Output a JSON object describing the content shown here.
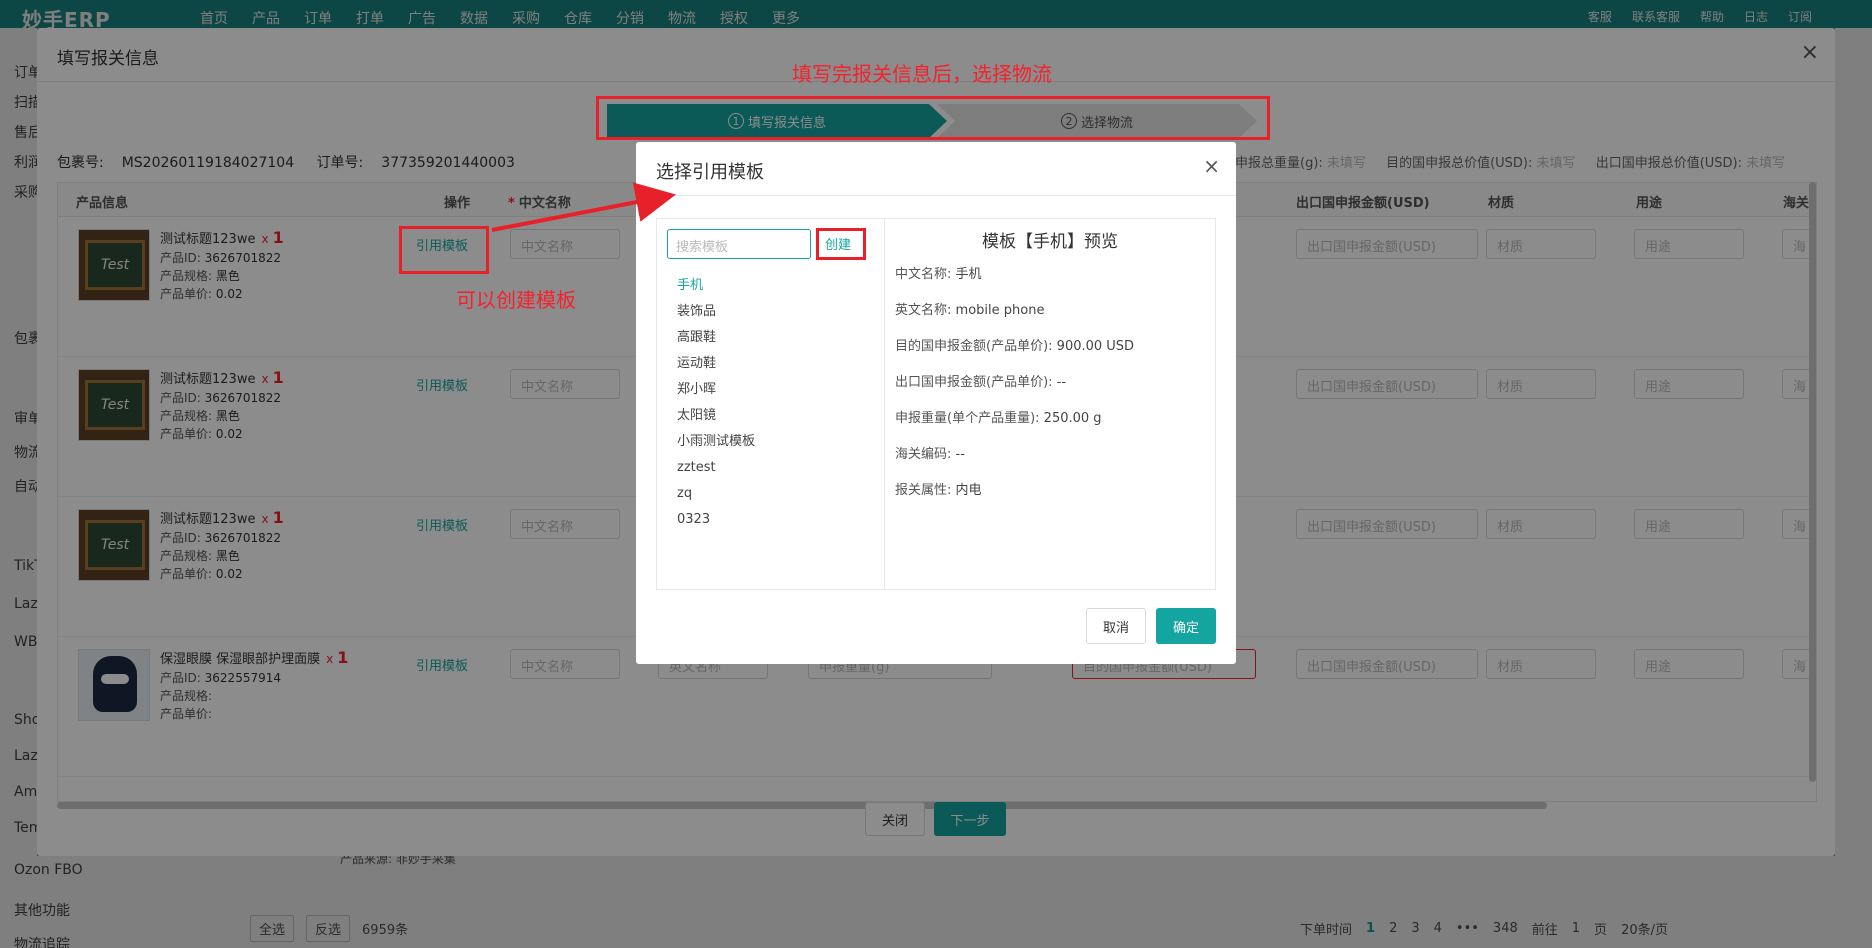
{
  "app": {
    "logo": "妙手ERP",
    "nav": [
      "首页",
      "产品",
      "订单",
      "打单",
      "广告",
      "数据",
      "采购",
      "仓库",
      "分销",
      "物流",
      "授权",
      "更多"
    ],
    "top_right": [
      "客服",
      "联系客服",
      "帮助",
      "日志",
      "订阅"
    ],
    "sidebar_items": [
      "订单",
      "扫描",
      "售后",
      "利润",
      "采购",
      "包裹",
      "审单",
      "物流",
      "自动",
      "TikTok",
      "Lazada",
      "WB",
      "Shopee",
      "Lazada",
      "Amazon",
      "Temu",
      "Ozon FBO",
      "其他功能",
      "物流追踪"
    ],
    "footer": {
      "select_all": "全选",
      "invert": "反选",
      "count": "6959条"
    },
    "pager": {
      "sort": "下单时间",
      "pages": [
        "1",
        "2",
        "3",
        "4",
        "•••",
        "348"
      ],
      "goto": "前往",
      "page_input": "1",
      "page_unit": "页",
      "page_size": "20条/页"
    },
    "strip_text": "产品来源: 非妙手采集"
  },
  "outer_modal": {
    "title": "填写报关信息",
    "annotation_top": "填写完报关信息后，选择物流",
    "annotation_left": "可以创建模板",
    "steps": [
      {
        "num": "1",
        "label": "填写报关信息"
      },
      {
        "num": "2",
        "label": "选择物流"
      }
    ],
    "package_no_label": "包裹号:",
    "package_no": "MS20260119184027104",
    "order_no_label": "订单号:",
    "order_no": "377359201440003",
    "right_info": [
      {
        "label": "申报总重量(g):",
        "value": "未填写"
      },
      {
        "label": "目的国申报总价值(USD):",
        "value": "未填写"
      },
      {
        "label": "出口国申报总价值(USD):",
        "value": "未填写"
      }
    ],
    "columns": {
      "product": "产品信息",
      "action": "操作",
      "cn_name": "中文名称",
      "export_amount": "出口国申报金额(USD)",
      "material": "材质",
      "usage": "用途",
      "customs": "海关"
    },
    "rows": [
      {
        "title": "测试标题123we",
        "qty_prefix": "x",
        "qty": "1",
        "id_label": "产品ID:",
        "id": "3626701822",
        "spec_label": "产品规格:",
        "spec": "黑色",
        "price_label": "产品单价:",
        "price": "0.02",
        "action": "引用模板",
        "image": "test-board"
      },
      {
        "title": "测试标题123we",
        "qty_prefix": "x",
        "qty": "1",
        "id_label": "产品ID:",
        "id": "3626701822",
        "spec_label": "产品规格:",
        "spec": "黑色",
        "price_label": "产品单价:",
        "price": "0.02",
        "action": "引用模板",
        "image": "test-board"
      },
      {
        "title": "测试标题123we",
        "qty_prefix": "x",
        "qty": "1",
        "id_label": "产品ID:",
        "id": "3626701822",
        "spec_label": "产品规格:",
        "spec": "黑色",
        "price_label": "产品单价:",
        "price": "0.02",
        "action": "引用模板",
        "image": "test-board"
      },
      {
        "title": "保湿眼膜 保湿眼部护理面膜",
        "qty_prefix": "x",
        "qty": "1",
        "id_label": "产品ID:",
        "id": "3622557914",
        "spec_label": "产品规格:",
        "spec": "",
        "price_label": "产品单价:",
        "price": "",
        "action": "引用模板",
        "image": "batman"
      }
    ],
    "placeholders": {
      "cn_name": "中文名称",
      "en_name": "英文名称",
      "weight": "申报重量(g)",
      "dest_amount": "目的国申报金额(USD)",
      "export_amount": "出口国申报金额(USD)",
      "material": "材质",
      "usage": "用途",
      "customs": "海"
    },
    "close_label": "关闭",
    "next_label": "下一步"
  },
  "inner_modal": {
    "title": "选择引用模板",
    "search_placeholder": "搜索模板",
    "create_label": "创建",
    "templates": [
      "手机",
      "装饰品",
      "高跟鞋",
      "运动鞋",
      "郑小晖",
      "太阳镜",
      "小雨测试模板",
      "zztest",
      "zq",
      "0323"
    ],
    "selected_index": 0,
    "preview_title": "模板【手机】预览",
    "preview": [
      {
        "k": "中文名称:",
        "v": "手机"
      },
      {
        "k": "英文名称:",
        "v": "mobile phone"
      },
      {
        "k": "目的国申报金额(产品单价):",
        "v": "900.00 USD"
      },
      {
        "k": "出口国申报金额(产品单价):",
        "v": "--"
      },
      {
        "k": "申报重量(单个产品重量):",
        "v": "250.00 g"
      },
      {
        "k": "海关编码:",
        "v": "--"
      },
      {
        "k": "报关属性:",
        "v": "内电"
      }
    ],
    "cancel_label": "取消",
    "ok_label": "确定"
  },
  "colors": {
    "accent": "#14a5a0",
    "annotation_red": "#e8202a",
    "topbar": "#1a8e8a"
  }
}
